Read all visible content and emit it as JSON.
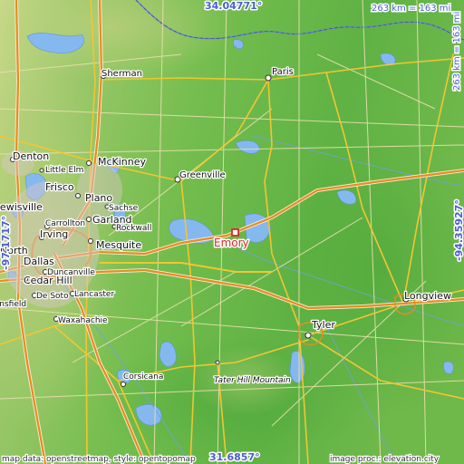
{
  "map": {
    "coords": {
      "top": "34.04771°",
      "bottom": "31.6857°",
      "left": "-97.1717°",
      "right": "-94.35927°"
    },
    "scale_top": "263 km = 163 mi",
    "scale_right": "263 km = 163 mi",
    "focus_city": "Emory",
    "credit_left": "map data: openstreetmap, style: opentopomap",
    "credit_right": "image proc.: elevation.city",
    "cities": {
      "sherman": "Sherman",
      "paris": "Paris",
      "denton": "Denton",
      "little_elm": "Little Elm",
      "mckinney": "McKinney",
      "greenville": "Greenville",
      "frisco": "Frisco",
      "plano": "Plano",
      "lewisville": "Lewisville",
      "sachse": "Sachse",
      "garland": "Garland",
      "rockwall": "Rockwall",
      "carrollton": "Carrollton",
      "irving": "Irving",
      "mesquite": "Mesquite",
      "north": "North",
      "dallas": "Dallas",
      "duncanville": "Duncanville",
      "cedar_hill": "Cedar Hill",
      "de_soto": "De Soto",
      "lancaster": "Lancaster",
      "mansfield": "Mansfield",
      "waxahachie": "Waxahachie",
      "corsicana": "Corsicana",
      "tyler": "Tyler",
      "longview": "Longview",
      "tater_hill": "Tater Hill Mountain"
    }
  }
}
